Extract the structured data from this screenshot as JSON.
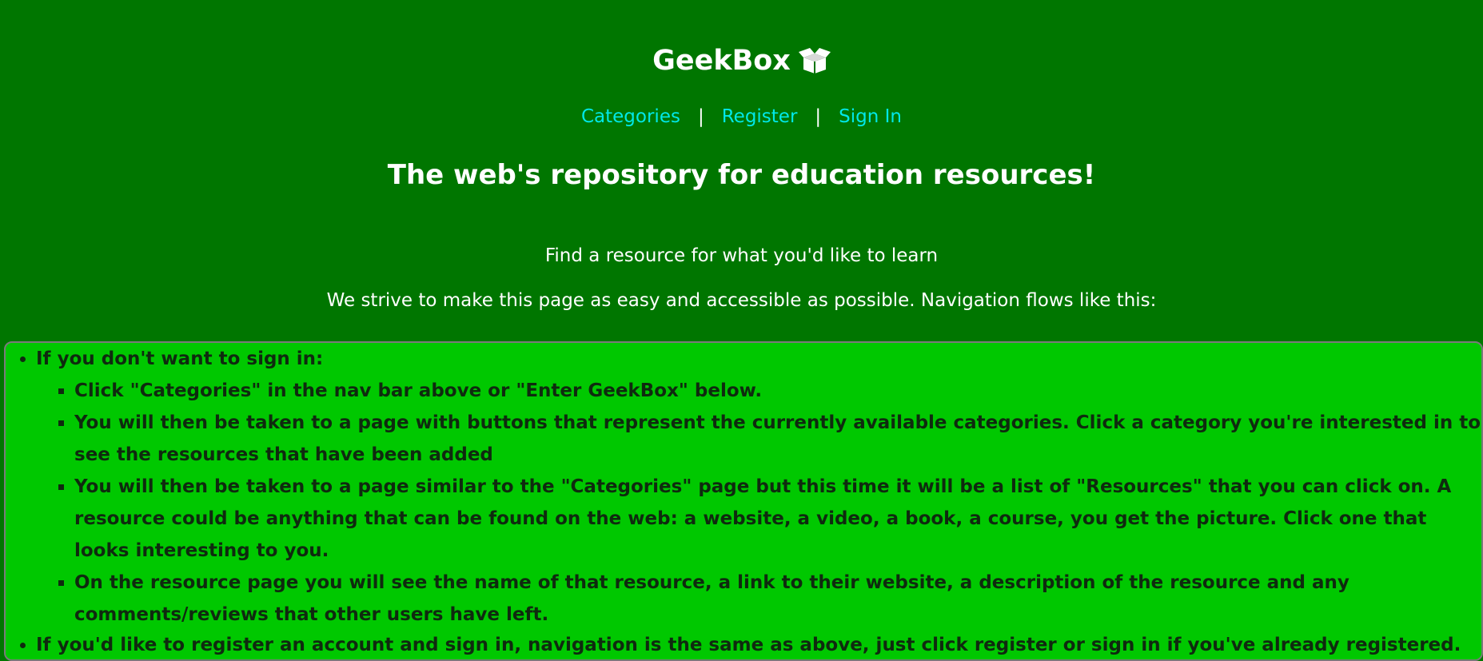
{
  "brand": {
    "name": "GeekBox",
    "icon": "open-box-icon"
  },
  "nav": {
    "categories": "Categories",
    "register": "Register",
    "sign_in": "Sign In",
    "separator": "|"
  },
  "tagline": "The web's repository for education resources!",
  "intro": {
    "line1": "Find a resource for what you'd like to learn",
    "line2": "We strive to make this page as easy and accessible as possible. Navigation flows like this:"
  },
  "instructions": {
    "no_signin": {
      "heading": "If you don't want to sign in:",
      "steps": [
        "Click \"Categories\" in the nav bar above or \"Enter GeekBox\" below.",
        "You will then be taken to a page with buttons that represent the currently available categories. Click a category you're interested in to see the resources that have been added",
        "You will then be taken to a page similar to the \"Categories\" page but this time it will be a list of \"Resources\" that you can click on. A resource could be anything that can be found on the web: a website, a video, a book, a course, you get the picture. Click one that looks interesting to you.",
        "On the resource page you will see the name of that resource, a link to their website, a description of the resource and any comments/reviews that other users have left."
      ]
    },
    "register": "If you'd like to register an account and sign in, navigation is the same as above, just click register or sign in if you've already registered. You will then have the capability to add categories, resources and comments/reviews."
  },
  "colors": {
    "background": "#007600",
    "panel": "#00c800",
    "link": "#00e8e8",
    "panel_text": "#0f2a0f"
  }
}
